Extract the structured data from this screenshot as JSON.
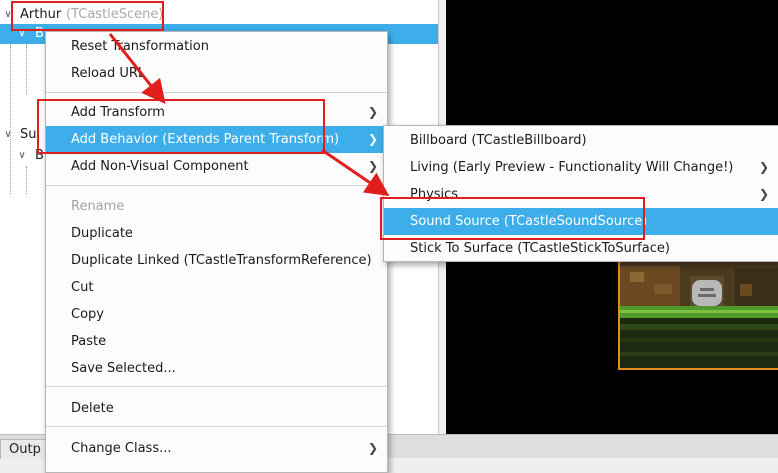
{
  "tree": {
    "root_name": "Arthur",
    "root_class": "(TCastleScene)",
    "rows": [
      "B",
      "Su",
      "B"
    ]
  },
  "bottom_tab": "Outp",
  "context_menu": {
    "items": [
      {
        "label": "Reset Transformation"
      },
      {
        "label": "Reload URL"
      },
      {
        "label": "Add Transform",
        "submenu": true
      },
      {
        "label": "Add Behavior (Extends Parent Transform)",
        "submenu": true,
        "highlighted": true
      },
      {
        "label": "Add Non-Visual Component",
        "submenu": true
      },
      {
        "label": "Rename",
        "disabled": true
      },
      {
        "label": "Duplicate"
      },
      {
        "label": "Duplicate Linked (TCastleTransformReference)"
      },
      {
        "label": "Cut"
      },
      {
        "label": "Copy"
      },
      {
        "label": "Paste"
      },
      {
        "label": "Save Selected..."
      },
      {
        "label": "Delete"
      },
      {
        "label": "Change Class...",
        "submenu": true
      }
    ]
  },
  "behavior_submenu": {
    "items": [
      {
        "label": "Billboard (TCastleBillboard)"
      },
      {
        "label": "Living (Early Preview - Functionality Will Change!)",
        "submenu": true
      },
      {
        "label": "Physics",
        "submenu": true
      },
      {
        "label": "Sound Source (TCastleSoundSource)",
        "highlighted": true
      },
      {
        "label": "Stick To Surface (TCastleStickToSurface)"
      }
    ]
  },
  "icons": {
    "submenu_arrow": "chevron-right-icon",
    "tree_toggle": "chevron-down-icon"
  },
  "colors": {
    "highlight": "#3daee9",
    "annotation": "#e01e1e",
    "viewport_bg": "#000000",
    "scene_border": "#e58a1f"
  }
}
